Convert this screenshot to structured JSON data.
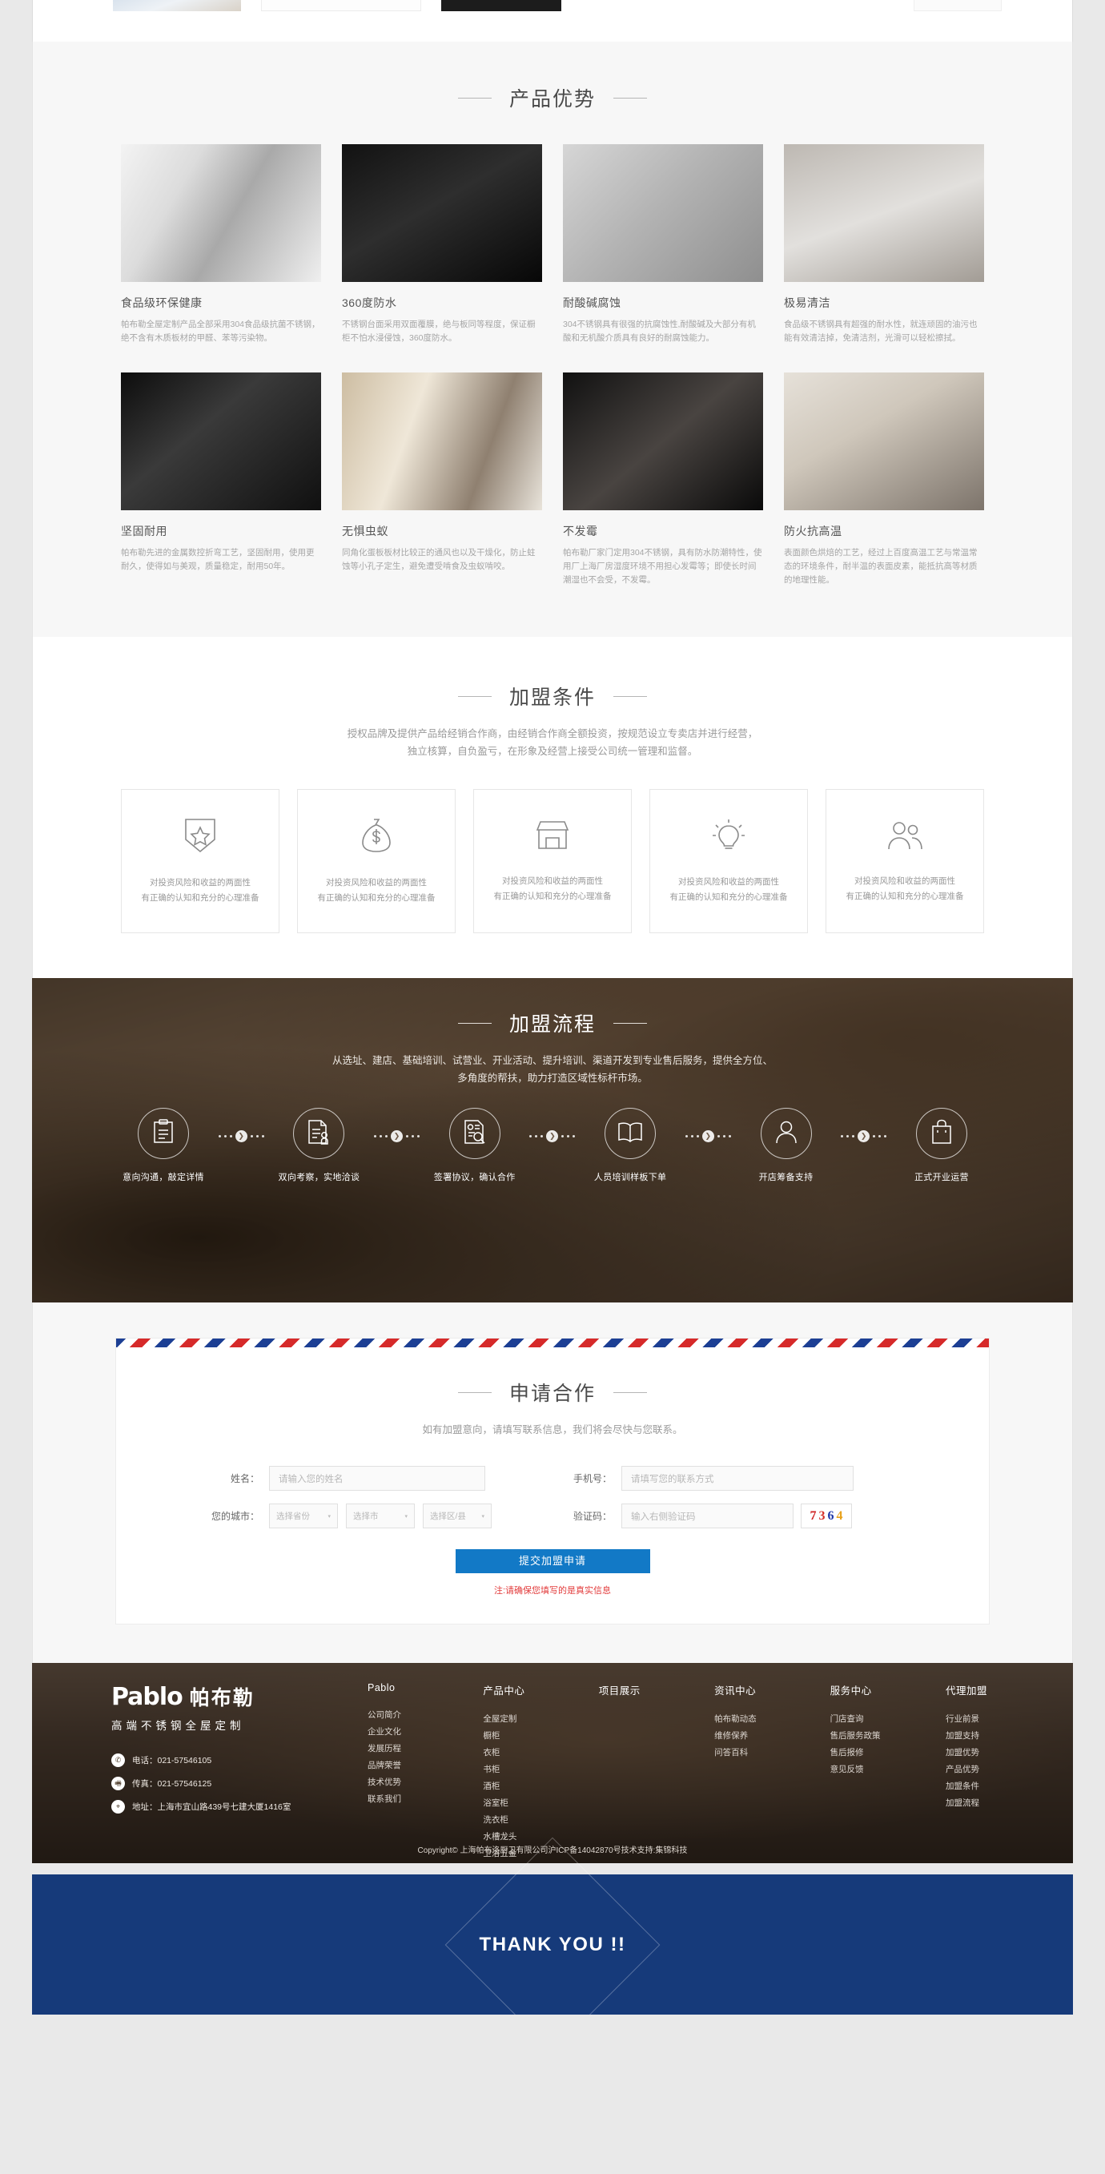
{
  "advantages": {
    "heading": "产品优势",
    "items": [
      {
        "title": "食品级环保健康",
        "desc": "帕布勒全屋定制产品全部采用304食品级抗菌不锈钢，绝不含有木质板材的甲醛、苯等污染物。",
        "photo": "sink-wash-vegetables"
      },
      {
        "title": "360度防水",
        "desc": "不锈钢台面采用双面覆膜，绝与板同等程度，保证橱柜不怕水浸侵蚀，360度防水。",
        "photo": "black-sink-waterdrops"
      },
      {
        "title": "耐酸碱腐蚀",
        "desc": "304不锈钢具有很强的抗腐蚀性,耐酸碱及大部分有机酸和无机酸介质具有良好的耐腐蚀能力。",
        "photo": "sink-drain-food-waste"
      },
      {
        "title": "极易清洁",
        "desc": "食品级不锈钢具有超强的耐水性，就连顽固的油污也能有效清洁掉，免清洁剂，光滑可以轻松擦拭。",
        "photo": "dish-rack-shelf"
      },
      {
        "title": "坚固耐用",
        "desc": "帕布勒先进的金属数控折弯工艺，坚固耐用，使用更耐久，使得如与美观，质量稳定，耐用50年。",
        "photo": "stainless-cooktop"
      },
      {
        "title": "无惧虫蚁",
        "desc": "同角化蛋板板材比较正的通风也以及干燥化，防止蛀蚀等小孔子定生，避免遭受啃食及虫蚁啃咬。",
        "photo": "wood-panel-samples"
      },
      {
        "title": "不发霉",
        "desc": "帕布勒厂家门定用304不锈钢，具有防水防潮特性，使用厂上海厂房湿度环境不用担心发霉等；即使长时间潮湿也不会受，不发霉。",
        "photo": "dark-kitchen-sink"
      },
      {
        "title": "防火抗高温",
        "desc": "表面颜色烘焙的工艺，经过上百度高温工艺与常温常态的环境条件，耐半温的表面皮素，能抵抗高等材质的地理性能。",
        "photo": "modern-kitchen-interior"
      }
    ]
  },
  "conditions": {
    "heading": "加盟条件",
    "sub_line1": "授权品牌及提供产品给经销合作商，由经销合作商全额投资，按规范设立专卖店并进行经营，",
    "sub_line2": "独立核算，自负盈亏，在形象及经营上接受公司统一管理和监督。",
    "cards": [
      {
        "icon": "shield-star-icon",
        "line1": "对投资风险和收益的两面性",
        "line2": "有正确的认知和充分的心理准备"
      },
      {
        "icon": "money-bag-icon",
        "line1": "对投资风险和收益的两面性",
        "line2": "有正确的认知和充分的心理准备"
      },
      {
        "icon": "storefront-icon",
        "line1": "对投资风险和收益的两面性",
        "line2": "有正确的认知和充分的心理准备"
      },
      {
        "icon": "lightbulb-icon",
        "line1": "对投资风险和收益的两面性",
        "line2": "有正确的认知和充分的心理准备"
      },
      {
        "icon": "people-group-icon",
        "line1": "对投资风险和收益的两面性",
        "line2": "有正确的认知和充分的心理准备"
      }
    ]
  },
  "process": {
    "heading": "加盟流程",
    "sub_line1": "从选址、建店、基础培训、试营业、开业活动、提升培训、渠道开发到专业售后服务，提供全方位、",
    "sub_line2": "多角度的帮扶，助力打造区域性标杆市场。",
    "steps": [
      {
        "icon": "clipboard-icon",
        "label": "意向沟通，敲定详情"
      },
      {
        "icon": "contract-stamp-icon",
        "label": "双向考察，实地洽谈"
      },
      {
        "icon": "document-search-icon",
        "label": "签署协议，确认合作"
      },
      {
        "icon": "open-book-icon",
        "label": "人员培训样板下单"
      },
      {
        "icon": "user-icon",
        "label": "开店筹备支持"
      },
      {
        "icon": "shopping-bag-icon",
        "label": "正式开业运营"
      }
    ],
    "arrow_glyph": "❯"
  },
  "apply": {
    "heading": "申请合作",
    "sub": "如有加盟意向，请填写联系信息，我们将会尽快与您联系。",
    "fields": {
      "name_label": "姓名：",
      "name_placeholder": "请输入您的姓名",
      "phone_label": "手机号：",
      "phone_placeholder": "请填写您的联系方式",
      "city_label": "您的城市：",
      "province_select": "选择省份",
      "city_select": "选择市",
      "district_select": "选择区/县",
      "captcha_label": "验证码：",
      "captcha_placeholder": "输入右侧验证码",
      "caret": "▾"
    },
    "captcha_chars": [
      {
        "char": "7",
        "color": "#cf2020"
      },
      {
        "char": "3",
        "color": "#d4302a"
      },
      {
        "char": "6",
        "color": "#1e36a8"
      },
      {
        "char": "4",
        "color": "#e8a21c"
      }
    ],
    "submit_label": "提交加盟申请",
    "submit_note": "注:请确保您填写的是真实信息",
    "accent": "#1279c6",
    "note_color": "#e23b3b"
  },
  "footer": {
    "logo_en": "Pablo",
    "logo_cn": "帕布勒",
    "slogan": "高端不锈钢全屋定制",
    "contacts": [
      {
        "icon": "phone-icon",
        "glyph": "✆",
        "text": "电话：021-57546105"
      },
      {
        "icon": "fax-icon",
        "glyph": "🖷",
        "text": "传真：021-57546125"
      },
      {
        "icon": "location-icon",
        "glyph": "⌖",
        "text": "地址：上海市宜山路439号七建大厦1416室"
      }
    ],
    "columns": [
      {
        "title": "Pablo",
        "links": [
          "公司简介",
          "企业文化",
          "发展历程",
          "品牌荣誉",
          "技术优势",
          "联系我们"
        ]
      },
      {
        "title": "产品中心",
        "links": [
          "全屋定制",
          "橱柜",
          "衣柜",
          "书柜",
          "酒柜",
          "浴室柜",
          "洗衣柜",
          "水槽龙头",
          "卫浴五金"
        ]
      },
      {
        "title": "项目展示",
        "links": []
      },
      {
        "title": "资讯中心",
        "links": [
          "帕布勒动态",
          "维修保养",
          "问答百科"
        ]
      },
      {
        "title": "服务中心",
        "links": [
          "门店查询",
          "售后服务政策",
          "售后报修",
          "意见反馈"
        ]
      },
      {
        "title": "代理加盟",
        "links": [
          "行业前景",
          "加盟支持",
          "加盟优势",
          "产品优势",
          "加盟条件",
          "加盟流程"
        ]
      }
    ],
    "copyright": "Copyright© 上海帕布洛厨卫有限公司沪ICP备14042870号技术支持:集锦科技"
  },
  "thanks": {
    "text": "THANK YOU !!",
    "bg": "#163a7a"
  }
}
